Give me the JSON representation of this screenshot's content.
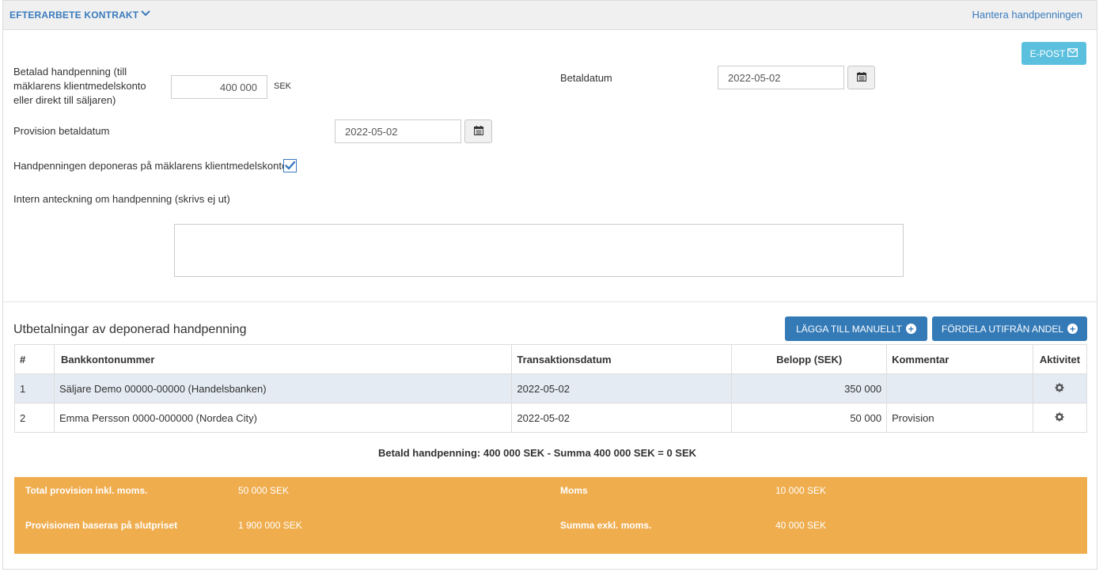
{
  "header": {
    "title": "EFTERARBETE KONTRAKT",
    "manage_link": "Hantera handpenningen"
  },
  "email_button": "E-POST",
  "form": {
    "paid_deposit_label": "Betalad handpenning (till mäklarens klientmedelskonto eller direkt till säljaren)",
    "paid_deposit_value": "400 000",
    "paid_deposit_unit": "SEK",
    "payment_date_label": "Betaldatum",
    "payment_date_value": "2022-05-02",
    "commission_date_label": "Provision betaldatum",
    "commission_date_value": "2022-05-02",
    "deposit_checkbox_label": "Handpenningen deponeras på mäklarens klientmedelskonto",
    "deposit_checkbox_checked": true,
    "note_label": "Intern anteckning om handpenning (skrivs ej ut)",
    "note_value": ""
  },
  "payouts": {
    "title": "Utbetalningar av deponerad handpenning",
    "add_manual_button": "LÄGGA TILL MANUELLT",
    "distribute_button": "FÖRDELA UTIFRÅN ANDEL",
    "columns": [
      "#",
      "Bankkontonummer",
      "Transaktionsdatum",
      "Belopp (SEK)",
      "Kommentar",
      "Aktivitet"
    ],
    "rows": [
      {
        "num": "1",
        "account": "Säljare Demo 00000-00000 (Handelsbanken)",
        "date": "2022-05-02",
        "amount": "350 000",
        "comment": ""
      },
      {
        "num": "2",
        "account": "Emma Persson 0000-000000 (Nordea City)",
        "date": "2022-05-02",
        "amount": "50 000",
        "comment": "Provision"
      }
    ],
    "summary": "Betald handpenning: 400 000 SEK - Summa 400 000 SEK = 0 SEK"
  },
  "commission": {
    "total_label": "Total provision inkl. moms.",
    "total_value": "50 000 SEK",
    "vat_label": "Moms",
    "vat_value": "10 000 SEK",
    "basis_label": "Provisionen baseras på slutpriset",
    "basis_value": "1 900 000 SEK",
    "excl_label": "Summa exkl. moms.",
    "excl_value": "40 000 SEK"
  },
  "colors": {
    "accent_blue": "#337ab7",
    "email_button": "#5bc0de",
    "commission_banner": "#efad4e",
    "highlight_row": "#e4ebf3"
  },
  "icons": [
    "chevron-down-icon",
    "envelope-icon",
    "calendar-icon",
    "checkmark-icon",
    "plus-circle-icon",
    "gear-icon"
  ]
}
